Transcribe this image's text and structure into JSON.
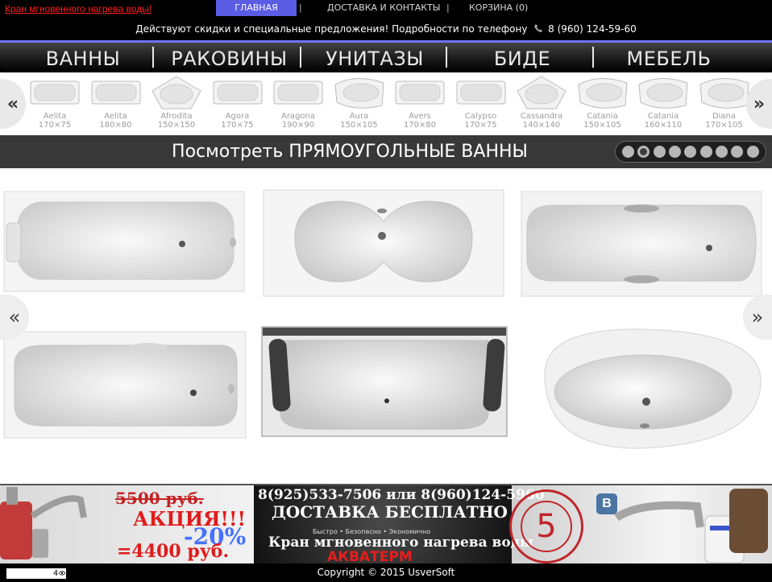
{
  "topbar": {
    "promo_link": "Кран мгновенного нагрева воды!",
    "nav": [
      {
        "label": "ГЛАВНАЯ"
      },
      {
        "label": "ДОСТАВКА И КОНТАКТЫ"
      },
      {
        "label": "КОРЗИНА (0)"
      }
    ],
    "separator": "|"
  },
  "infobar": {
    "text": "Действуют скидки и специальные предложения! Подробности по телефону",
    "phone": "8 (960) 124-59-60"
  },
  "categories": [
    {
      "label": "ВАННЫ"
    },
    {
      "label": "РАКОВИНЫ"
    },
    {
      "label": "УНИТАЗЫ"
    },
    {
      "label": "БИДЕ"
    },
    {
      "label": "МЕБЕЛЬ"
    }
  ],
  "thumbs": [
    {
      "name": "Aelita",
      "size": "170×75"
    },
    {
      "name": "Aelita",
      "size": "180×80"
    },
    {
      "name": "Afrodita",
      "size": "150×150"
    },
    {
      "name": "Agora",
      "size": "170×75"
    },
    {
      "name": "Aragona",
      "size": "190×90"
    },
    {
      "name": "Aura",
      "size": "150×105"
    },
    {
      "name": "Avers",
      "size": "170×80"
    },
    {
      "name": "Calypso",
      "size": "170×75"
    },
    {
      "name": "Cassandra",
      "size": "140×140"
    },
    {
      "name": "Catania",
      "size": "150×105"
    },
    {
      "name": "Catania",
      "size": "160×110"
    },
    {
      "name": "Diana",
      "size": "170×105"
    }
  ],
  "arrows": {
    "prev": "«",
    "next": "»"
  },
  "section": {
    "title": "Посмотреть ПРЯМОУГОЛЬНЫЕ ВАННЫ",
    "pages": 9,
    "active_page": 2
  },
  "banner": {
    "old_price": "5500 руб.",
    "promo": "АКЦИЯ!!!",
    "new_price": "=4400 руб.",
    "discount": "-20%",
    "phones": "8(925)533-7506 или 8(960)124-5960",
    "delivery": "ДОСТАВКА БЕСПЛАТНО",
    "slogan": "Быстро • Безопасно • Экономично",
    "product": "Кран мгновенного нагрева воды",
    "brand": "АКВАТЕРМ",
    "warranty": "5",
    "vk": "В"
  },
  "footer": {
    "counter": "4",
    "copyright": "Copyright © 2015 UsverSoft"
  },
  "colors": {
    "accent": "#6d73ff",
    "nav_active": "#5a5ce4",
    "promo_red": "#ff1e1e"
  }
}
